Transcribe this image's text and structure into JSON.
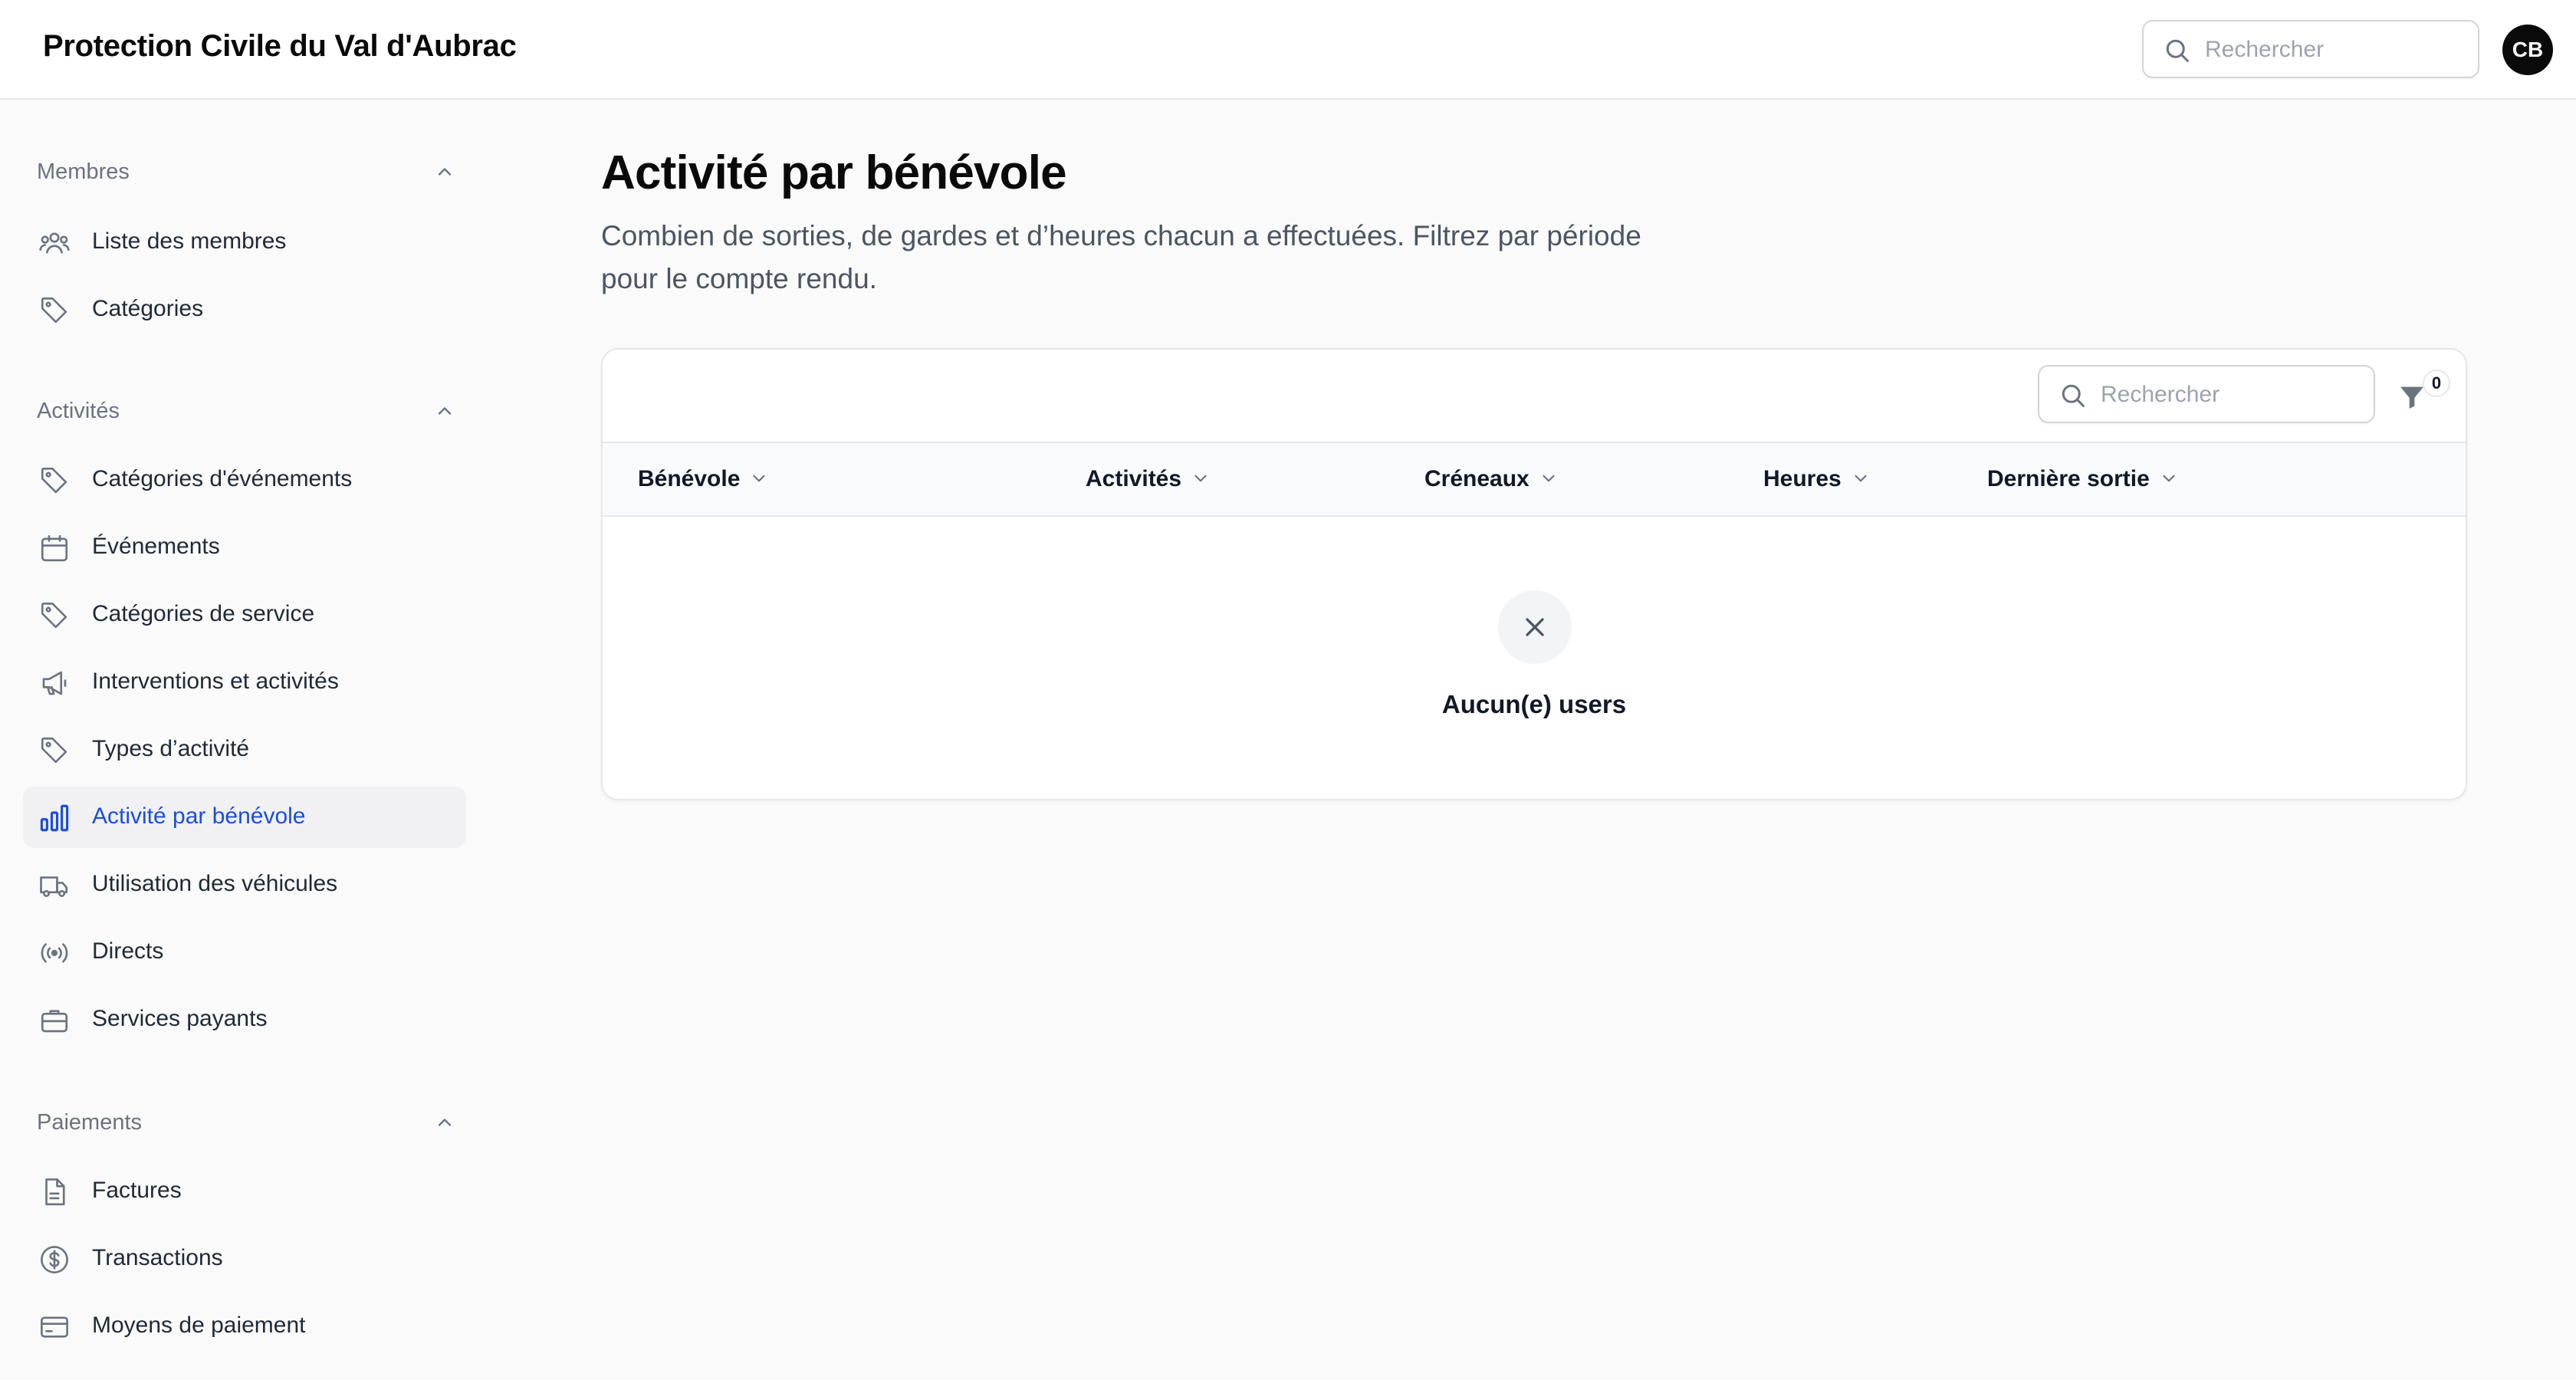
{
  "app": {
    "title": "Protection Civile du Val d'Aubrac",
    "search_placeholder": "Rechercher",
    "user_initials": "CB"
  },
  "sidebar": {
    "groups": [
      {
        "label": "Membres",
        "items": [
          {
            "label": "Liste des membres",
            "icon": "users-icon"
          },
          {
            "label": "Catégories",
            "icon": "tag-icon"
          }
        ]
      },
      {
        "label": "Activités",
        "items": [
          {
            "label": "Catégories d'événements",
            "icon": "tag-icon"
          },
          {
            "label": "Événements",
            "icon": "calendar-icon"
          },
          {
            "label": "Catégories de service",
            "icon": "tag-icon"
          },
          {
            "label": "Interventions et activités",
            "icon": "megaphone-icon"
          },
          {
            "label": "Types d’activité",
            "icon": "tag-icon"
          },
          {
            "label": "Activité par bénévole",
            "icon": "bar-chart-icon",
            "active": true
          },
          {
            "label": "Utilisation des véhicules",
            "icon": "truck-icon"
          },
          {
            "label": "Directs",
            "icon": "broadcast-icon"
          },
          {
            "label": "Services payants",
            "icon": "briefcase-icon"
          }
        ]
      },
      {
        "label": "Paiements",
        "items": [
          {
            "label": "Factures",
            "icon": "document-icon"
          },
          {
            "label": "Transactions",
            "icon": "dollar-circle-icon"
          },
          {
            "label": "Moyens de paiement",
            "icon": "credit-card-icon"
          }
        ]
      }
    ]
  },
  "page": {
    "title": "Activité par bénévole",
    "description": "Combien de sorties, de gardes et d’heures chacun a effectuées. Filtrez par période pour le compte rendu."
  },
  "table": {
    "search_placeholder": "Rechercher",
    "filter_count": "0",
    "columns": [
      "Bénévole",
      "Activités",
      "Créneaux",
      "Heures",
      "Dernière sortie"
    ],
    "empty_text": "Aucun(e) users"
  },
  "colors": {
    "accent": "#1d4ed8",
    "active_bg": "#f1f1f3",
    "muted": "#6b7280"
  }
}
